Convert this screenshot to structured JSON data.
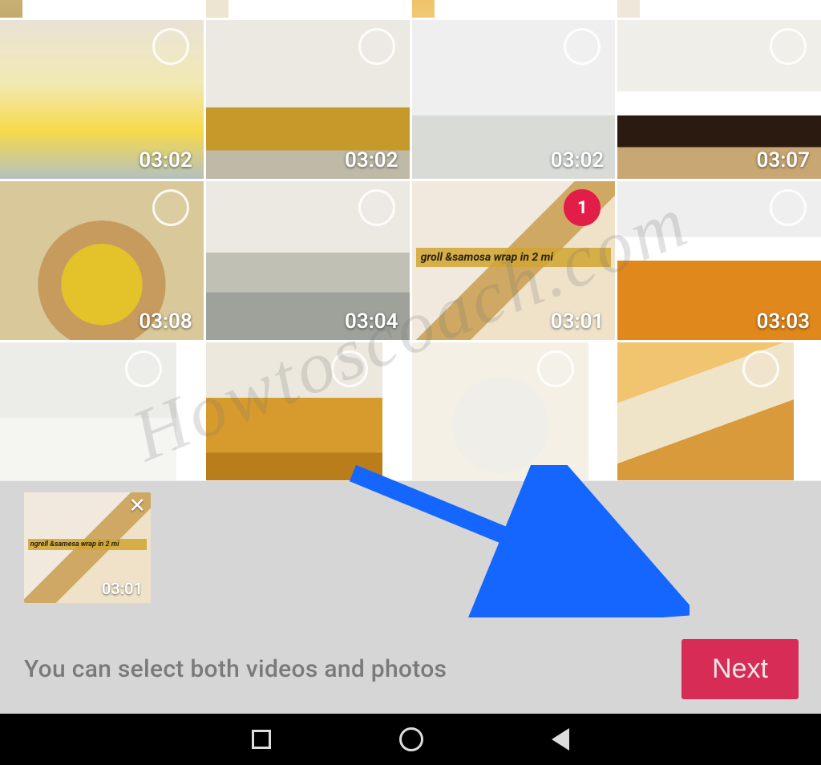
{
  "watermark": "Howtoscoach.com",
  "grid": {
    "row0": [
      {
        "duration": "",
        "selected": false
      },
      {
        "duration": "",
        "selected": false
      },
      {
        "duration": "",
        "selected": false
      },
      {
        "duration": "",
        "selected": false
      }
    ],
    "row1": [
      {
        "duration": "03:02",
        "selected": false
      },
      {
        "duration": "03:02",
        "selected": false
      },
      {
        "duration": "03:02",
        "selected": false
      },
      {
        "duration": "03:07",
        "selected": false
      }
    ],
    "row2": [
      {
        "duration": "03:08",
        "selected": false
      },
      {
        "duration": "03:04",
        "selected": false
      },
      {
        "duration": "03:01",
        "selected": true,
        "badge": "1",
        "collage_text": "groll &samosa wrap in 2 mi"
      },
      {
        "duration": "03:03",
        "selected": false
      }
    ],
    "row3": [
      {
        "duration": "",
        "selected": false
      },
      {
        "duration": "",
        "selected": false
      },
      {
        "duration": "",
        "selected": false
      },
      {
        "duration": "",
        "selected": false
      }
    ]
  },
  "selected_tray": [
    {
      "duration": "03:01",
      "collage_text": "ngrell &samesa wrap in 2 mi"
    }
  ],
  "action": {
    "hint": "You can select both videos and photos",
    "next": "Next"
  }
}
